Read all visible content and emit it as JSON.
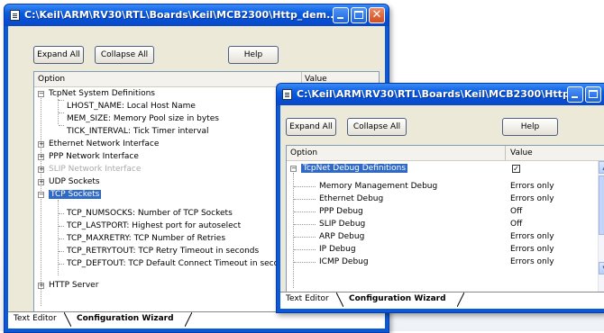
{
  "window_back": {
    "title": "C:\\Keil\\ARM\\RV30\\RTL\\Boards\\Keil\\MCB2300\\Http_dem...",
    "buttons": {
      "expand": "Expand All",
      "collapse": "Collapse All",
      "help": "Help"
    },
    "columns": {
      "option": "Option",
      "value": "Value"
    },
    "rows": [
      "TcpNet System Definitions",
      "LHOST_NAME: Local Host Name",
      "MEM_SIZE: Memory Pool size in bytes",
      "TICK_INTERVAL: Tick Timer interval",
      "Ethernet Network Interface",
      "PPP Network Interface",
      "SLIP Network Interface",
      "UDP Sockets",
      "TCP Sockets",
      "TCP_NUMSOCKS: Number of TCP Sockets",
      "TCP_LASTPORT: Highest port for autoselect",
      "TCP_MAXRETRY: TCP Number of Retries",
      "TCP_RETRYTOUT: TCP Retry Timeout in seconds",
      "TCP_DEFTOUT: TCP Default Connect Timeout in seconds",
      "HTTP Server"
    ],
    "tabs": {
      "text_editor": "Text Editor",
      "config_wizard": "Configuration Wizard"
    }
  },
  "window_front": {
    "title": "C:\\Keil\\ARM\\RV30\\RTL\\Boards\\Keil\\MCB2300\\Http...",
    "buttons": {
      "expand": "Expand All",
      "collapse": "Collapse All",
      "help": "Help"
    },
    "columns": {
      "option": "Option",
      "value": "Value"
    },
    "rows": [
      {
        "label": "TcpNet Debug Definitions",
        "value": "✓"
      },
      {
        "label": "Memory Management Debug",
        "value": "Errors only"
      },
      {
        "label": "Ethernet Debug",
        "value": "Errors only"
      },
      {
        "label": "PPP Debug",
        "value": "Off"
      },
      {
        "label": "SLIP Debug",
        "value": "Off"
      },
      {
        "label": "ARP Debug",
        "value": "Errors only"
      },
      {
        "label": "IP Debug",
        "value": "Errors only"
      },
      {
        "label": "ICMP Debug",
        "value": "Errors only"
      }
    ],
    "tabs": {
      "text_editor": "Text Editor",
      "config_wizard": "Configuration Wizard"
    }
  },
  "colors": {
    "titlebar": "#0a5ce0",
    "selection": "#316ac5",
    "client": "#ece9d8"
  }
}
